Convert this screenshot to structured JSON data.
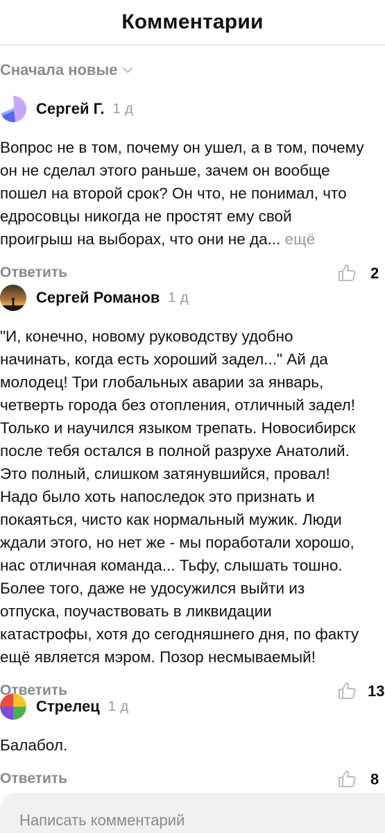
{
  "header": {
    "title": "Комментарии"
  },
  "sort": {
    "label": "Сначала новые",
    "icon": "chevron-down-icon"
  },
  "comments": [
    {
      "author": "Сергей Г.",
      "time": "1 д",
      "text_lines": [
        "Вопрос не в том, почему он ушел, а в том, почему",
        "он не сделал этого раньше, зачем он вообще",
        "пошел на второй срок? Он что, не понимал, что",
        "едросовцы никогда не простят ему свой",
        "проигрыш на выборах, что они не да..."
      ],
      "more_label": "ещё",
      "reply_label": "Ответить",
      "likes": "2"
    },
    {
      "author": "Сергей Романов",
      "time": "1 д",
      "text_lines": [
        "\"И, конечно, новому руководству удобно",
        "начинать, когда есть хороший задел...\" Ай да",
        "молодец! Три глобальных аварии за январь,",
        "четверть города без отопления, отличный задел!",
        "Только и научился языком трепать. Новосибирск",
        "после тебя остался в полной разрухе Анатолий.",
        "Это полный, слишком затянувшийся, провал!",
        "Надо было хоть напоследок это признать и",
        "покаяться, чисто как нормальный мужик. Люди",
        "ждали этого, но нет же - мы поработали хорошо,",
        "нас отличная команда... Тьфу, слышать тошно.",
        "Более того, даже не удосужился выйти из",
        "отпуска, поучаствовать в ликвидации",
        "катастрофы, хотя до сегодняшнего дня, по факту",
        "ещё является мэром. Позор несмываемый!"
      ],
      "reply_label": "Ответить",
      "likes": "13"
    },
    {
      "author": "Стрелец",
      "time": "1 д",
      "text_lines": [
        "Балабол."
      ],
      "reply_label": "Ответить",
      "likes": "8"
    }
  ],
  "composer": {
    "placeholder": "Написать комментарий"
  }
}
